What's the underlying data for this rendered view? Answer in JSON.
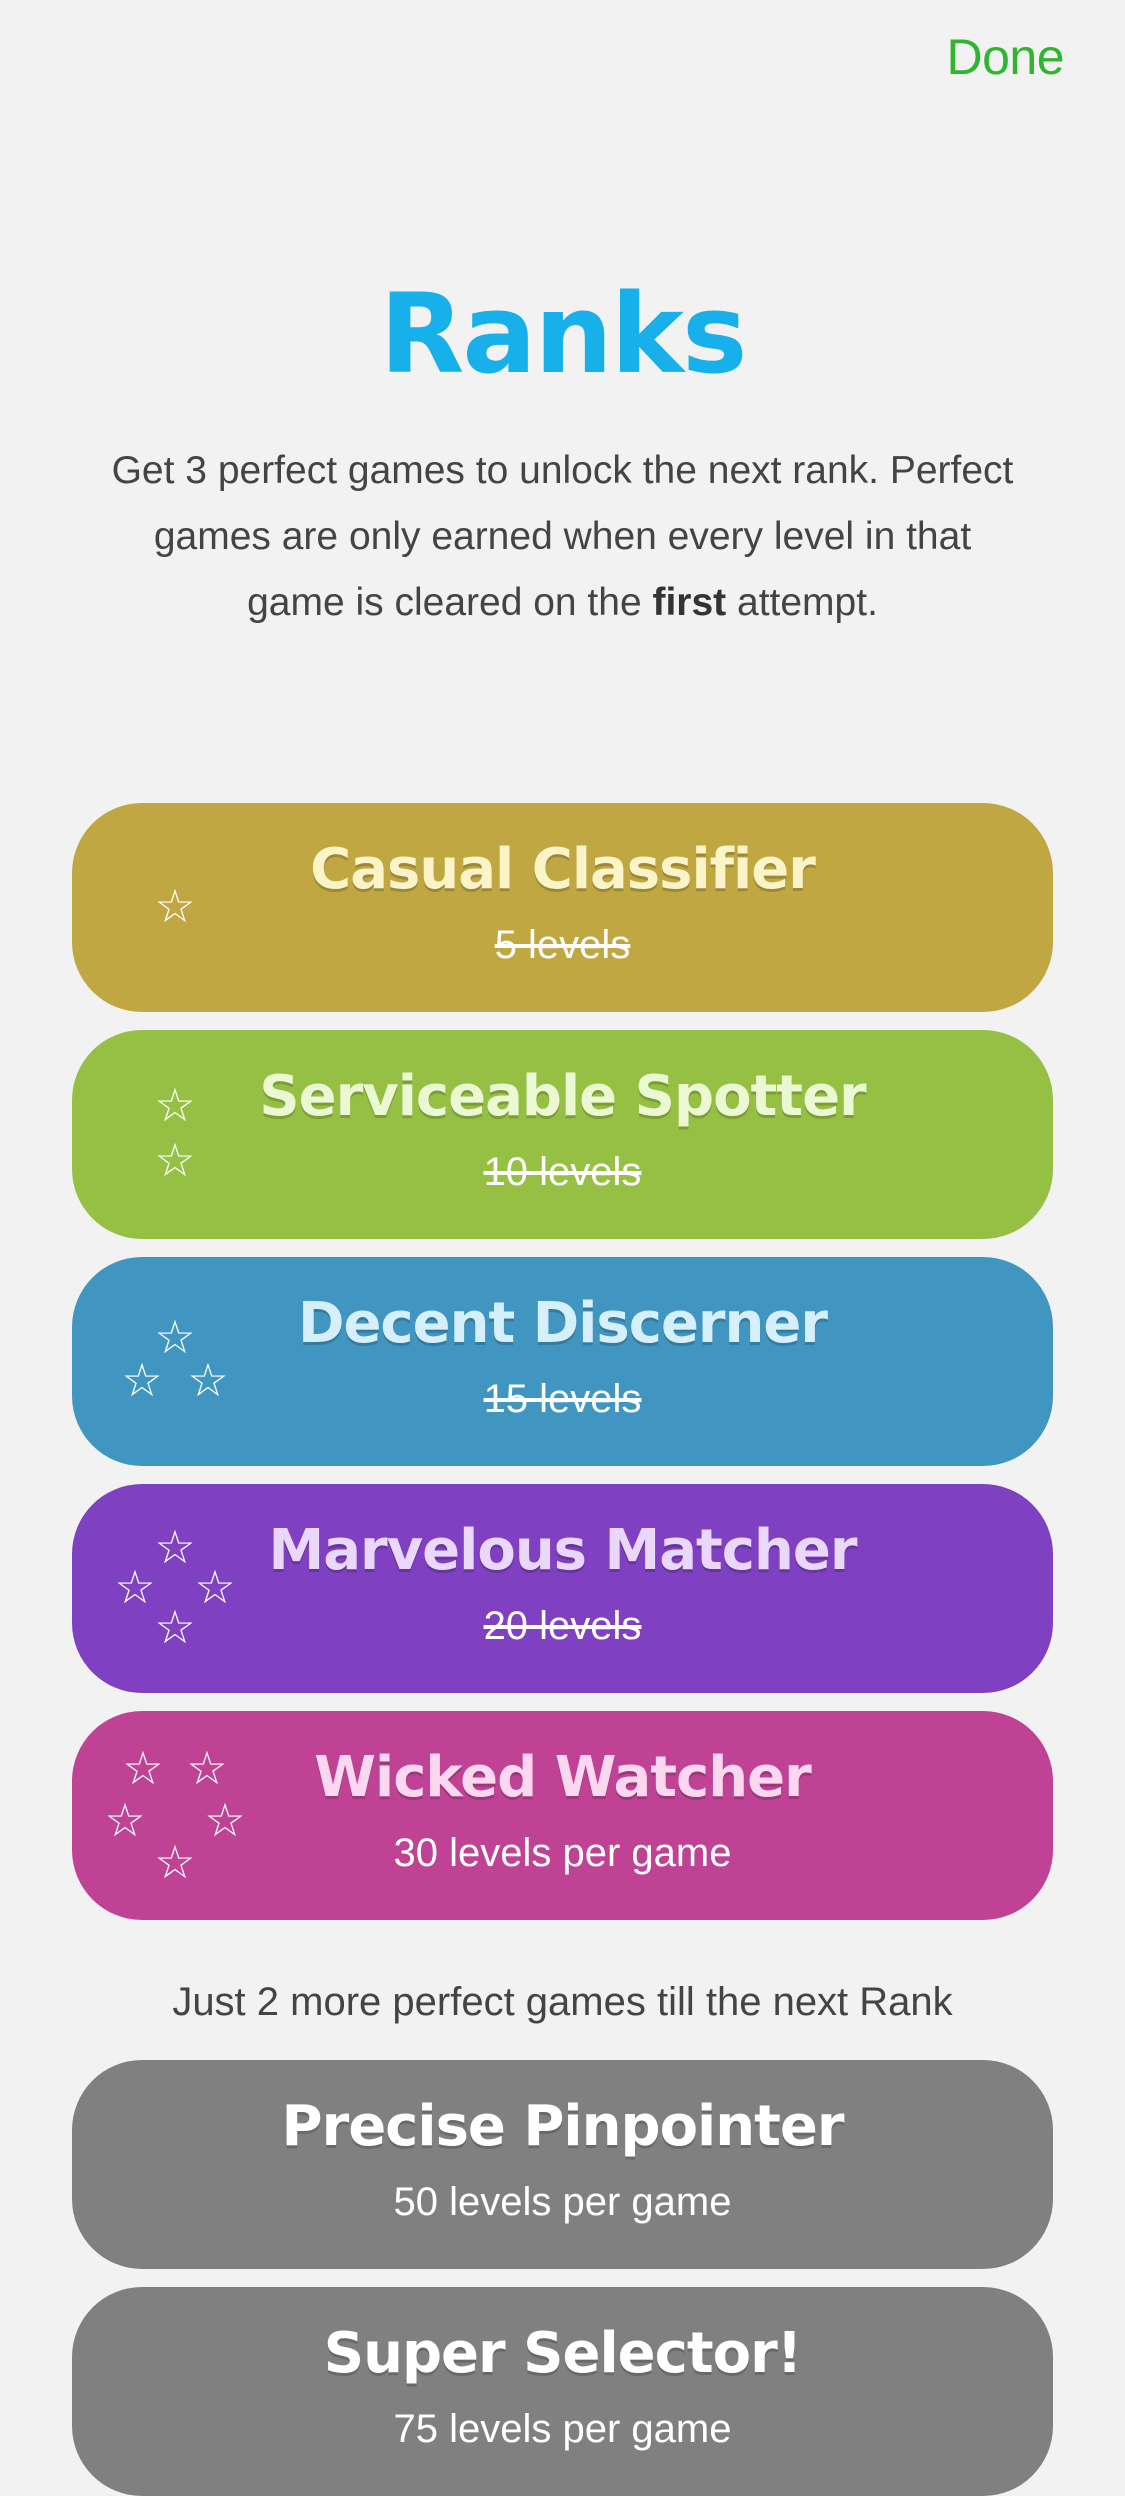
{
  "header": {
    "done_label": "Done"
  },
  "title": "Ranks",
  "intro": {
    "before": "Get 3 perfect games to unlock the next rank. Perfect games are only earned when every level in that game is cleared on the ",
    "emphasis": "first",
    "after": " attempt."
  },
  "colors": {
    "accent_done": "#2fb52f",
    "title": "#18b0ea",
    "locked": "#808080"
  },
  "unlocked_ranks": [
    {
      "name": "Casual Classifier",
      "levels": "5 levels",
      "stars": 1,
      "color": "#c0a742",
      "name_color": "#fbf4c8",
      "completed": true
    },
    {
      "name": "Serviceable Spotter",
      "levels": "10 levels",
      "stars": 2,
      "color": "#95c043",
      "name_color": "#ecf7d4",
      "completed": true
    },
    {
      "name": "Decent Discerner",
      "levels": "15 levels",
      "stars": 3,
      "color": "#4096c1",
      "name_color": "#d6f0fb",
      "completed": true
    },
    {
      "name": "Marvelous Matcher",
      "levels": "20 levels",
      "stars": 4,
      "color": "#7f40c1",
      "name_color": "#e9d8fb",
      "completed": true
    },
    {
      "name": "Wicked Watcher",
      "levels": "30 levels per game",
      "stars": 5,
      "color": "#c04295",
      "name_color": "#fbd8ef",
      "completed": false
    }
  ],
  "next_rank_note": "Just 2 more perfect games till the next Rank",
  "locked_ranks": [
    {
      "name": "Precise Pinpointer",
      "levels": "50 levels per game"
    },
    {
      "name": "Super Selector!",
      "levels": "75 levels per game"
    }
  ],
  "icons": {
    "star": "star-outline-icon"
  }
}
